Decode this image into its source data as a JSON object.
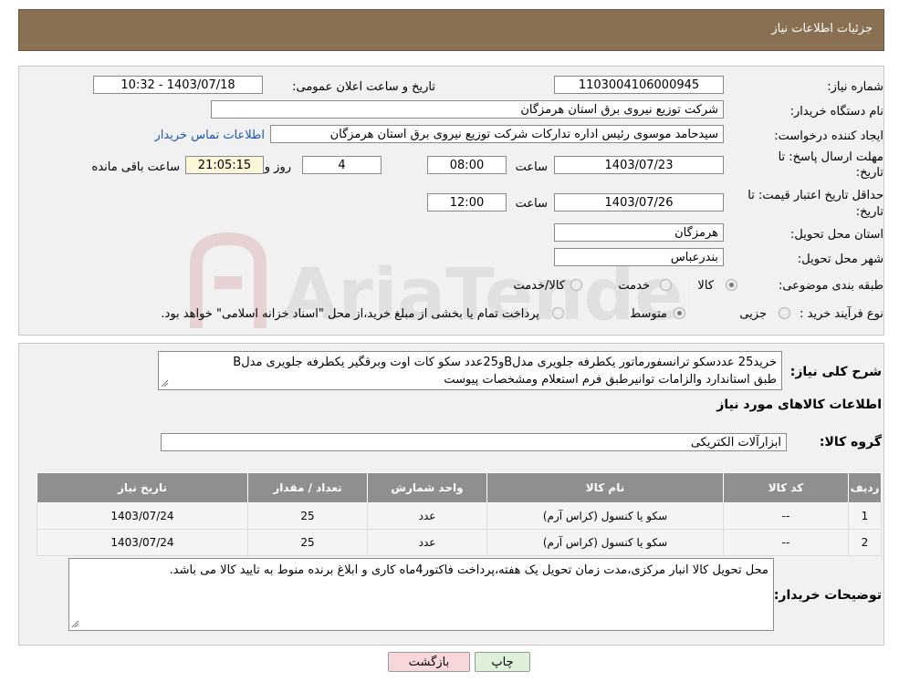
{
  "header": {
    "title": "جزئیات اطلاعات نیاز"
  },
  "watermark": {
    "text": "AriaTender.neT"
  },
  "info": {
    "need_number": {
      "label": "شماره نیاز:",
      "value": "1103004106000945"
    },
    "announce": {
      "label": "تاریخ و ساعت اعلان عمومی:",
      "value": "1403/07/18 - 10:32"
    },
    "buyer": {
      "label": "نام دستگاه خریدار:",
      "value": "شرکت توزیع نیروی برق استان هرمزگان"
    },
    "creator": {
      "label": "ایجاد کننده درخواست:",
      "value": "سیدحامد موسوی رئیس اداره تدارکات شرکت توزیع نیروی برق استان هرمزگان",
      "contact_link": "اطلاعات تماس خریدار"
    },
    "deadline": {
      "label_line1": "مهلت ارسال پاسخ: تا",
      "label_line2": "تاریخ:",
      "date": "1403/07/23",
      "time_label": "ساعت",
      "time": "08:00",
      "days": "4",
      "days_label": "روز و",
      "remaining": "21:05:15",
      "remaining_label": "ساعت باقی مانده"
    },
    "validity": {
      "label_line1": "حداقل تاریخ اعتبار قیمت: تا",
      "label_line2": "تاریخ:",
      "date": "1403/07/26",
      "time_label": "ساعت",
      "time": "12:00"
    },
    "province": {
      "label": "استان محل تحویل:",
      "value": "هرمزگان"
    },
    "city": {
      "label": "شهر محل تحویل:",
      "value": "بندرعباس"
    },
    "category": {
      "label": "طبقه بندی موضوعی:",
      "options": [
        "کالا",
        "خدمت",
        "کالا/خدمت"
      ],
      "selected": "کالا"
    },
    "process": {
      "label": "نوع فرآیند خرید :",
      "options": [
        "جزیی",
        "متوسط"
      ],
      "selected": "متوسط",
      "note": "پرداخت تمام یا بخشی از مبلغ خرید،از محل \"اسناد خزانه اسلامی\" خواهد بود."
    }
  },
  "summary": {
    "label": "شرح کلی نیاز:",
    "text_line1": "خرید25 عددسکو ترانسفورماتور یکطرفه جلویری مدلBو25عدد سکو کات اوت وبرقگیر یکطرفه جلویری مدلB",
    "text_line2": "طبق استاندارد والزامات توانیرطبق فرم استعلام ومشخصات پیوست"
  },
  "goods": {
    "section_title": "اطلاعات کالاهای مورد نیاز",
    "group_label": "گروه کالا:",
    "group_value": "ابزارآلات الکتریکی",
    "columns": [
      "ردیف",
      "کد کالا",
      "نام کالا",
      "واحد شمارش",
      "تعداد / مقدار",
      "تاریخ نیاز"
    ],
    "rows": [
      {
        "index": "1",
        "code": "--",
        "name": "سکو یا کنسول (کراس آرم)",
        "unit": "عدد",
        "qty": "25",
        "date": "1403/07/24"
      },
      {
        "index": "2",
        "code": "--",
        "name": "سکو یا کنسول (کراس آرم)",
        "unit": "عدد",
        "qty": "25",
        "date": "1403/07/24"
      }
    ]
  },
  "buyer_notes": {
    "label": "توضیحات خریدار:",
    "text": "محل تحویل کالا انبار مرکزی،مدت زمان تحویل یک هفته،پرداخت فاکتور4ماه کاری و ابلاغ برنده منوط به تایید کالا می باشد."
  },
  "buttons": {
    "print": "چاپ",
    "back": "بازگشت"
  },
  "colors": {
    "header_bg": "#8a7052",
    "table_header_bg": "#8f8f8f",
    "back_button_bg": "#f8d7da",
    "print_button_bg": "#dff0d8",
    "link": "#1a57b0"
  }
}
